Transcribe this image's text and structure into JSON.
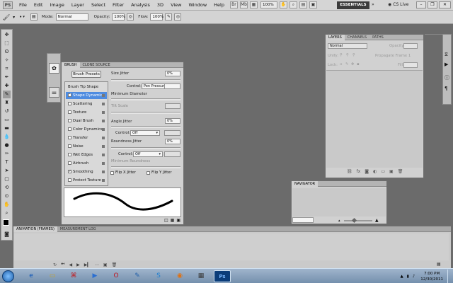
{
  "menubar": {
    "logo": "PS",
    "items": [
      "File",
      "Edit",
      "Image",
      "Layer",
      "Select",
      "Filter",
      "Analysis",
      "3D",
      "View",
      "Window",
      "Help"
    ],
    "zoom": "100%",
    "workspace": "ESSENTIALS",
    "cs_live": "CS Live"
  },
  "options": {
    "mode_label": "Mode:",
    "mode_value": "Normal",
    "opacity_label": "Opacity:",
    "opacity_value": "100%",
    "flow_label": "Flow:",
    "flow_value": "100%"
  },
  "brush": {
    "tabs": [
      "BRUSH",
      "CLONE SOURCE"
    ],
    "presets_button": "Brush Presets",
    "tip_items": [
      {
        "label": "Brush Tip Shape",
        "checkbox": false,
        "checked": false,
        "selected": false
      },
      {
        "label": "Shape Dynamics",
        "checkbox": true,
        "checked": true,
        "selected": true
      },
      {
        "label": "Scattering",
        "checkbox": true,
        "checked": false,
        "selected": false
      },
      {
        "label": "Texture",
        "checkbox": true,
        "checked": false,
        "selected": false
      },
      {
        "label": "Dual Brush",
        "checkbox": true,
        "checked": false,
        "selected": false
      },
      {
        "label": "Color Dynamics",
        "checkbox": true,
        "checked": false,
        "selected": false
      },
      {
        "label": "Transfer",
        "checkbox": true,
        "checked": false,
        "selected": false
      },
      {
        "label": "Noise",
        "checkbox": true,
        "checked": false,
        "selected": false
      },
      {
        "label": "Wet Edges",
        "checkbox": true,
        "checked": false,
        "selected": false
      },
      {
        "label": "Airbrush",
        "checkbox": true,
        "checked": false,
        "selected": false
      },
      {
        "label": "Smoothing",
        "checkbox": true,
        "checked": true,
        "selected": false
      },
      {
        "label": "Protect Texture",
        "checkbox": true,
        "checked": false,
        "selected": false
      }
    ],
    "size_jitter_label": "Size Jitter",
    "size_jitter_value": "0%",
    "control_label": "Control:",
    "control_size_value": "Pen Pressure",
    "min_diameter_label": "Minimum Diameter",
    "tilt_scale_label": "Tilt Scale",
    "angle_jitter_label": "Angle Jitter",
    "angle_jitter_value": "0%",
    "control_angle_value": "Off",
    "roundness_jitter_label": "Roundness Jitter",
    "roundness_jitter_value": "0%",
    "control_roundness_value": "Off",
    "min_roundness_label": "Minimum Roundness",
    "flip_x_label": "Flip X Jitter",
    "flip_y_label": "Flip Y Jitter"
  },
  "layers": {
    "tabs": [
      "LAYERS",
      "CHANNELS",
      "PATHS"
    ],
    "blend_mode": "Normal",
    "opacity_label": "Opacity:",
    "unify_label": "Unify:",
    "propagate_label": "Propagate Frame 1",
    "lock_label": "Lock:",
    "fill_label": "Fill:"
  },
  "navigator": {
    "tabs": [
      "NAVIGATOR"
    ]
  },
  "animation": {
    "tabs": [
      "ANIMATION (FRAMES)",
      "MEASUREMENT LOG"
    ]
  },
  "taskbar": {
    "time": "7:00 PM",
    "date": "12/30/2011"
  },
  "colors": {
    "canvas_bg": "#6b6b6b",
    "selection_blue": "#4f8ce0"
  }
}
